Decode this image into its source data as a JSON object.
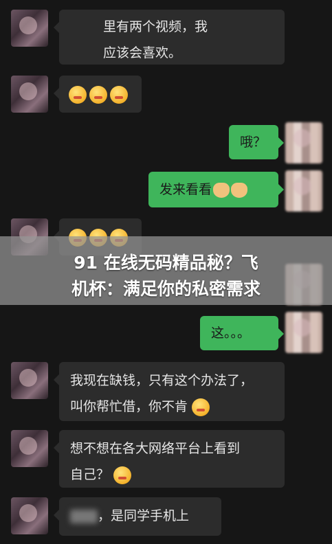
{
  "messages": [
    {
      "side": "in",
      "lines": [
        "里有两个视频，我",
        "应该会喜欢。"
      ]
    },
    {
      "side": "in",
      "emoji_count": 3
    },
    {
      "side": "out",
      "text": "哦？"
    },
    {
      "side": "out",
      "text": "发来看看"
    },
    {
      "side": "in",
      "emoji_count": 3
    },
    {
      "side": "out",
      "text": "这。。。"
    },
    {
      "side": "in",
      "lines": [
        "我现在缺钱，只有这个办法了，",
        "叫你帮忙借，你不肯"
      ]
    },
    {
      "side": "in",
      "lines": [
        "想不想在各大网络平台上看到",
        "自己？"
      ]
    },
    {
      "side": "in",
      "text": "，是同学手机上"
    }
  ],
  "overlay": {
    "title_line1": "91 在线无码精品秘？飞",
    "title_line2": "机杯：满足你的私密需求"
  }
}
